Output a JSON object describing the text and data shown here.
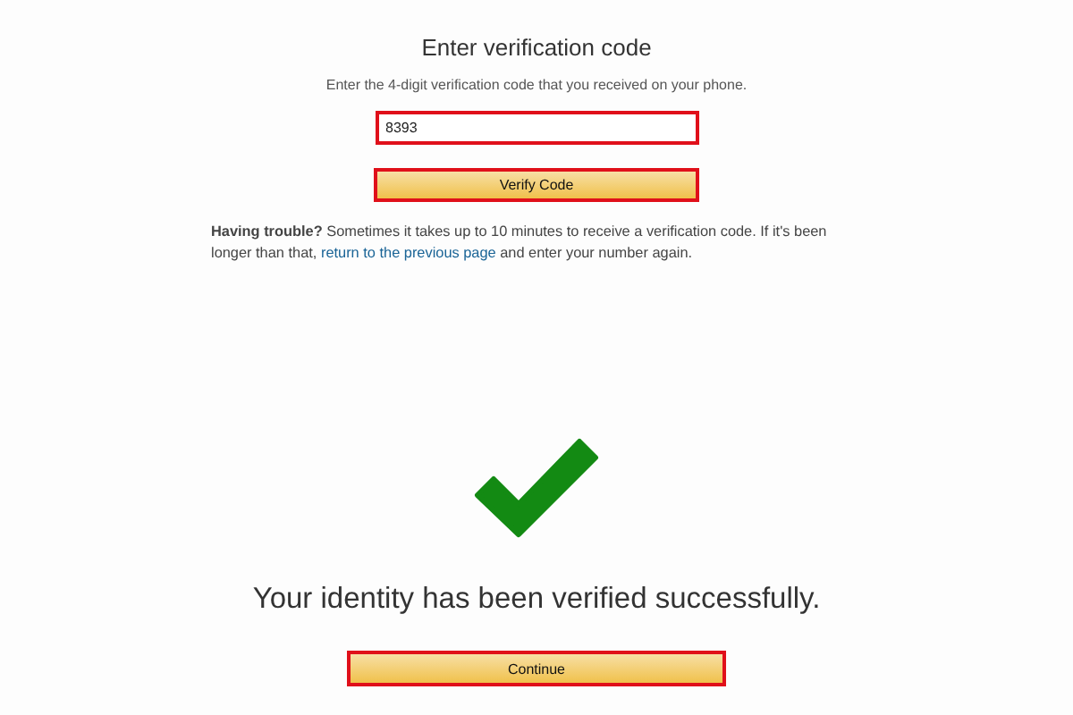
{
  "title": "Enter verification code",
  "instructions": "Enter the 4-digit verification code that you received on your phone.",
  "code_field": {
    "value": "8393",
    "highlighted": true
  },
  "verify_button": {
    "label": "Verify Code",
    "highlighted": true
  },
  "help": {
    "text_before": "**Having trouble?** Sometimes it takes up to 10 minutes to receive a verification code. If it's been longer than that,",
    "link": "return to the previous page",
    "text_after": "and enter your number again."
  },
  "success_message": "Your identity has been verified successfully.",
  "continue_button": {
    "label": "Continue",
    "highlighted": true
  }
}
